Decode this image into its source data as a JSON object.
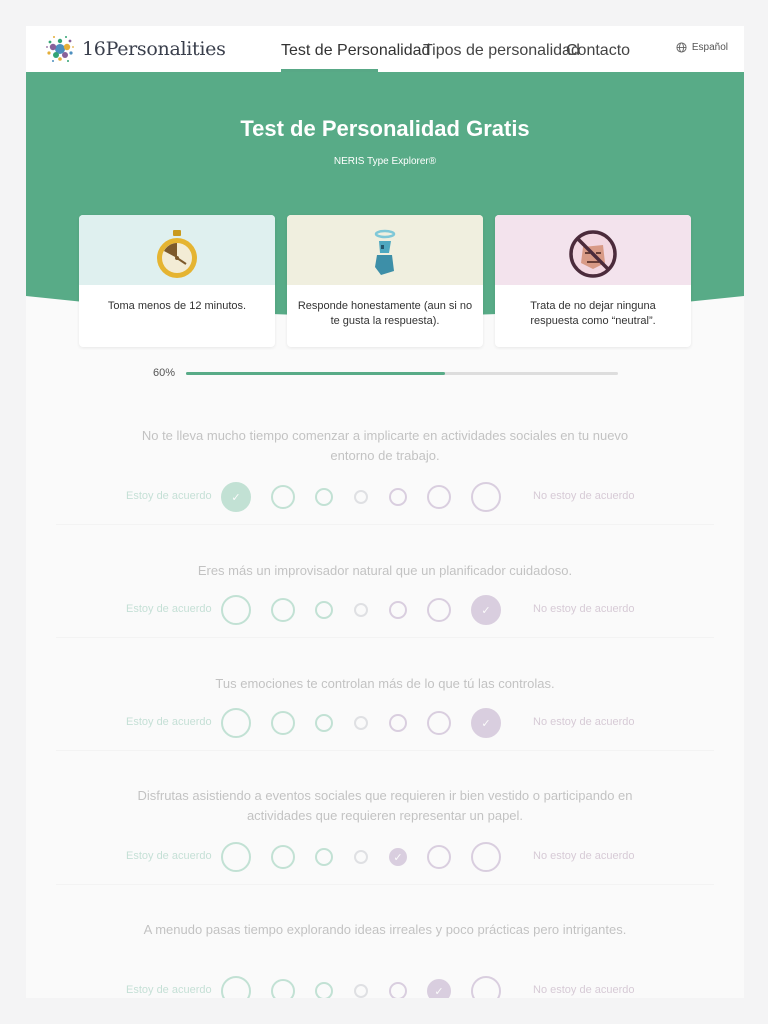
{
  "header": {
    "brand": "16Personalities",
    "nav": [
      {
        "label": "Test de Personalidad",
        "active": true
      },
      {
        "label": "Tipos de personalidad",
        "active": false
      },
      {
        "label": "Contacto",
        "active": false
      }
    ],
    "language": "Español"
  },
  "hero": {
    "title": "Test de Personalidad Gratis",
    "subtitle": "NERIS Type Explorer®"
  },
  "cards": [
    {
      "icon": "stopwatch-icon",
      "text": "Toma menos de 12 minutos.",
      "bg": "#dff0ef"
    },
    {
      "icon": "angel-figure-icon",
      "text": "Responde honestamente (aun si no te gusta la respuesta).",
      "bg": "#f0efdf"
    },
    {
      "icon": "no-neutral-face-icon",
      "text": "Trata de no dejar ninguna respuesta como “neutral”.",
      "bg": "#f3e3ed"
    }
  ],
  "progress": {
    "label": "60%",
    "value": 0.6
  },
  "scale": {
    "agree_label": "Estoy de acuerdo",
    "disagree_label": "No estoy de acuerdo"
  },
  "questions": [
    {
      "text": "No te lleva mucho tiempo comenzar a implicarte en actividades sociales en tu nuevo entorno de trabajo.",
      "selected": 0
    },
    {
      "text": "Eres más un improvisador natural que un planificador cuidadoso.",
      "selected": 6
    },
    {
      "text": "Tus emociones te controlan más de lo que tú las controlas.",
      "selected": 6
    },
    {
      "text": "Disfrutas asistiendo a eventos sociales que requieren ir bien vestido o participando en actividades que requieren representar un papel.",
      "selected": 4
    },
    {
      "text": "A menudo pasas tiempo explorando ideas irreales y poco prácticas pero intrigantes.",
      "selected": 5
    }
  ],
  "colors": {
    "agree": "#33a474",
    "disagree": "#88619a",
    "neutral": "#9b9faa",
    "hero": "#58ab87"
  }
}
